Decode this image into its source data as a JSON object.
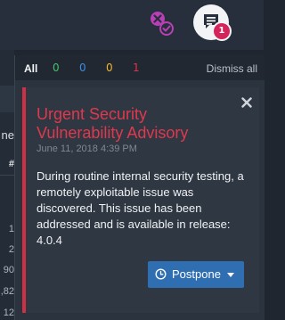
{
  "top_icons": {
    "tasks_icon": "tasks-close-icon",
    "notifications_icon": "chat-notification-icon",
    "notification_count": "1"
  },
  "background": {
    "fragments": [
      "ne",
      "#",
      "1",
      "2",
      "90",
      ",82",
      "12"
    ]
  },
  "notifications": {
    "tabs": [
      {
        "label": "All",
        "color": "#f2f4f6"
      },
      {
        "label": "0",
        "color": "#44c26a"
      },
      {
        "label": "0",
        "color": "#3d8de0"
      },
      {
        "label": "0",
        "color": "#f1b530"
      },
      {
        "label": "1",
        "color": "#e0314a"
      }
    ],
    "dismiss_all": "Dismiss all",
    "card": {
      "title": "Urgent Security Vulnerability Advisory",
      "date": "June 11, 2018 4:39 PM",
      "body": "During routine internal security testing, a remotely exploitable issue was discovered. This issue has been addressed and is available in release: 4.0.4",
      "accent_color": "#d03045",
      "postpone_label": "Postpone"
    }
  }
}
